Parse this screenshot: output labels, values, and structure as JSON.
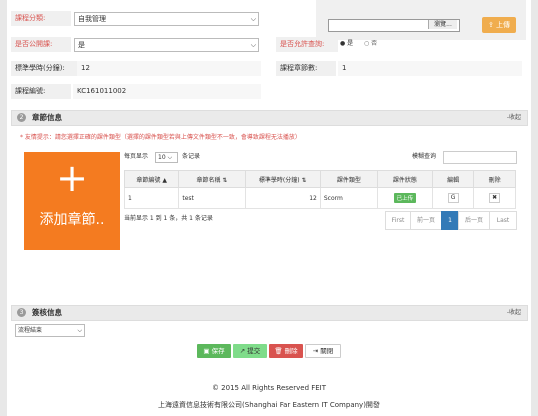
{
  "form": {
    "category": {
      "label": "課程分類:",
      "value": "自我管理"
    },
    "is_public": {
      "label": "是否公開課:",
      "value": "是"
    },
    "allow_query": {
      "label": "是否允許查詢:",
      "opt_yes": "是",
      "opt_no": "否"
    },
    "std_hours": {
      "label": "標準學時(分鐘):",
      "value": "12"
    },
    "chapter_count": {
      "label": "課程章節數:",
      "value": "1"
    },
    "course_id": {
      "label": "課程編號:",
      "value": "KC161011002"
    }
  },
  "upload": {
    "browse_label": "瀏覽...",
    "upload_label": "上傳"
  },
  "chapters": {
    "num": "2",
    "title": "章節信息",
    "collapse": "-收起",
    "tip": "* 友情提示：請您選擇正確的課件類型（選擇的課件類型若與上傳文件類型不一致，會導致課程无法播放）",
    "add_label": "添加章節..",
    "per_page_pre": "每页显示",
    "per_page_value": "10",
    "per_page_post": "条记录",
    "search_label": "模糊查询",
    "columns": [
      "章節編號",
      "章節名稱",
      "標準學時(分鐘)",
      "課件類型",
      "課件狀態",
      "編輯",
      "刪除"
    ],
    "rows": [
      {
        "no": "1",
        "name": "test",
        "hours": "12",
        "type": "Scorm",
        "status": "已上传"
      }
    ],
    "summary": "当前显示 1 到 1 条，共 1 条记录",
    "pager": {
      "first": "First",
      "prev": "前一页",
      "current": "1",
      "next": "后一页",
      "last": "Last"
    }
  },
  "review": {
    "num": "3",
    "title": "簽核信息",
    "collapse": "-收起",
    "flow_value": "流程結束"
  },
  "actions": {
    "save": "保存",
    "submit": "提交",
    "delete": "刪除",
    "close": "關閉"
  },
  "footer": {
    "copyright": "© 2015 All Rights Reserved FEIT",
    "company": "上海遠資信息技術有限公司(Shanghai Far Eastern IT Company)開發"
  },
  "colors": {
    "accent_orange": "#f47b20",
    "primary_blue": "#337ab7",
    "save_green": "#5cb85c",
    "submit_green": "#7fdc8a",
    "delete_red": "#d9534f"
  }
}
